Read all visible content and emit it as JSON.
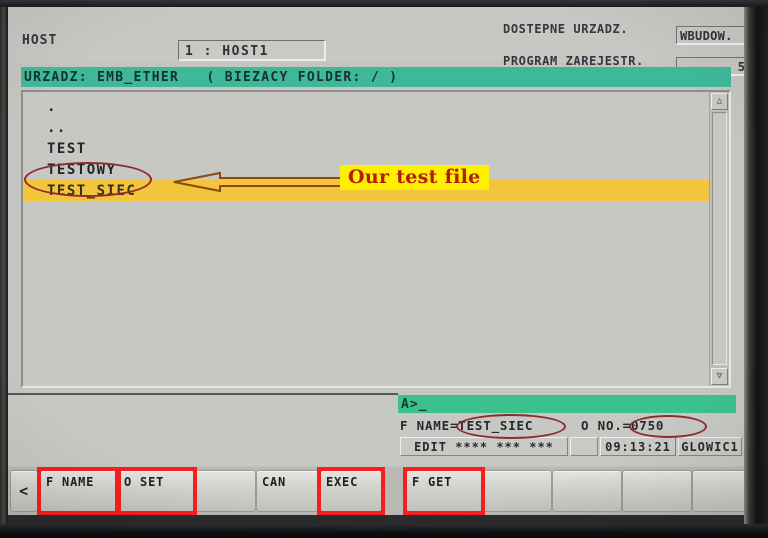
{
  "header": {
    "host_label": "HOST",
    "host_value": "1 : HOST1",
    "devices_label": "DOSTEPNE URZADZ.",
    "devices_value": "WBUDOW.",
    "programs_label": "PROGRAM ZAREJESTR.",
    "programs_value": "5"
  },
  "device_bar": {
    "text": "URZADZ: EMB_ETHER   ( BIEZACY FOLDER: / )"
  },
  "file_list": {
    "items": [
      {
        "name": ".",
        "selected": false
      },
      {
        "name": "..",
        "selected": false
      },
      {
        "name": "TEST",
        "selected": false
      },
      {
        "name": "TESTOWY",
        "selected": false
      },
      {
        "name": "TEST_SIEC",
        "selected": true
      }
    ],
    "scroll_up_icon": "scroll-up-arrow-icon",
    "scroll_down_icon": "scroll-down-arrow-icon"
  },
  "status": {
    "command_line": "A>_",
    "file_name_text": "F NAME=TEST_SIEC",
    "o_number_text": "O NO.=0750",
    "mode": "EDIT **** *** ***",
    "blank": "",
    "time": "09:13:21",
    "head": "GLOWIC1"
  },
  "softkeys_left": [
    {
      "label": "<",
      "name": "softkey-prev-page",
      "highlighted": false
    },
    {
      "label": "F NAME",
      "name": "softkey-f-name",
      "highlighted": true
    },
    {
      "label": "O SET",
      "name": "softkey-o-set",
      "highlighted": true
    },
    {
      "label": "",
      "name": "softkey-blank-1",
      "highlighted": false
    },
    {
      "label": "CAN",
      "name": "softkey-can",
      "highlighted": false
    },
    {
      "label": "EXEC",
      "name": "softkey-exec",
      "highlighted": true
    }
  ],
  "softkeys_right": [
    {
      "label": "F GET",
      "name": "softkey-f-get",
      "highlighted": true
    },
    {
      "label": "",
      "name": "softkey-blank-2",
      "highlighted": false
    },
    {
      "label": "",
      "name": "softkey-blank-3",
      "highlighted": false
    },
    {
      "label": "",
      "name": "softkey-blank-4",
      "highlighted": false
    },
    {
      "label": "",
      "name": "softkey-blank-5",
      "highlighted": false
    },
    {
      "label": "",
      "name": "softkey-blank-6",
      "highlighted": false
    }
  ],
  "annotations": {
    "callout_text": "Our test file",
    "callout_color": "#b51a10",
    "callout_background": "#fff000",
    "ellipse_color": "#8e2b30",
    "arrow_color": "#8a4a10",
    "highlight_box_color": "#f51f1f",
    "row_highlight_color": "#f5c63f"
  }
}
